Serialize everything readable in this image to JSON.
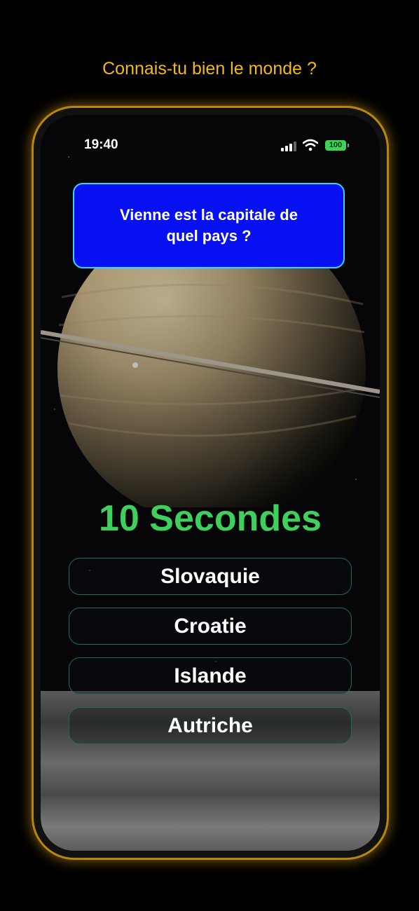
{
  "caption": "Connais-tu bien le monde ?",
  "status_bar": {
    "time": "19:40",
    "battery": "100"
  },
  "quiz": {
    "question": "Vienne est la capitale de quel pays ?",
    "timer": "10 Secondes",
    "answers": [
      {
        "label": "Slovaquie"
      },
      {
        "label": "Croatie"
      },
      {
        "label": "Islande"
      },
      {
        "label": "Autriche"
      }
    ]
  },
  "colors": {
    "caption": "#f2b81f",
    "question_bg": "#0610f0",
    "question_border": "#38d3ff",
    "timer": "#3fcf5d",
    "answer_border": "#1f6a58",
    "phone_frame": "#b8860b"
  },
  "icons": [
    "signal-icon",
    "wifi-icon",
    "battery-icon"
  ]
}
